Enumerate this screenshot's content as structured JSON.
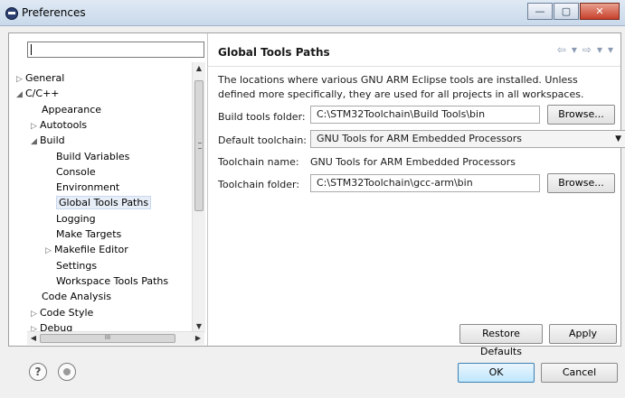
{
  "window": {
    "title": "Preferences",
    "minimize": "—",
    "maximize": "▢",
    "close": "✕"
  },
  "filter": {
    "value": ""
  },
  "tree": [
    {
      "label": "General",
      "arrow": "▷",
      "indent": 0
    },
    {
      "label": "C/C++",
      "arrow": "◢",
      "indent": 0
    },
    {
      "label": "Appearance",
      "arrow": "",
      "indent": 1
    },
    {
      "label": "Autotools",
      "arrow": "▷",
      "indent": 1
    },
    {
      "label": "Build",
      "arrow": "◢",
      "indent": 1
    },
    {
      "label": "Build Variables",
      "arrow": "",
      "indent": 2
    },
    {
      "label": "Console",
      "arrow": "",
      "indent": 2
    },
    {
      "label": "Environment",
      "arrow": "",
      "indent": 2
    },
    {
      "label": "Global Tools Paths",
      "arrow": "",
      "indent": 2,
      "selected": true
    },
    {
      "label": "Logging",
      "arrow": "",
      "indent": 2
    },
    {
      "label": "Make Targets",
      "arrow": "",
      "indent": 2
    },
    {
      "label": "Makefile Editor",
      "arrow": "▷",
      "indent": 2
    },
    {
      "label": "Settings",
      "arrow": "",
      "indent": 2
    },
    {
      "label": "Workspace Tools Paths",
      "arrow": "",
      "indent": 2
    },
    {
      "label": "Code Analysis",
      "arrow": "",
      "indent": 1
    },
    {
      "label": "Code Style",
      "arrow": "▷",
      "indent": 1
    },
    {
      "label": "Debug",
      "arrow": "▷",
      "indent": 1
    }
  ],
  "page": {
    "title": "Global Tools Paths",
    "nav": {
      "back": "⇦",
      "back_menu": "▾",
      "forward": "⇨",
      "forward_menu": "▾",
      "view_menu": "▾"
    },
    "description": "The locations where various GNU ARM Eclipse tools are installed. Unless defined more specifically, they are used for all projects in all workspaces.",
    "build_tools_label": "Build tools folder:",
    "build_tools_value": "C:\\STM32Toolchain\\Build Tools\\bin",
    "default_toolchain_label": "Default toolchain:",
    "default_toolchain_value": "GNU Tools for ARM Embedded Processors",
    "toolchain_name_label": "Toolchain name:",
    "toolchain_name_value": "GNU Tools for ARM Embedded Processors",
    "toolchain_folder_label": "Toolchain folder:",
    "toolchain_folder_value": "C:\\STM32Toolchain\\gcc-arm\\bin",
    "browse": "Browse...",
    "restore_defaults": "Restore Defaults",
    "apply": "Apply"
  },
  "footer": {
    "help": "?",
    "ok": "OK",
    "cancel": "Cancel"
  },
  "scroll": {
    "up": "▲",
    "down": "▼",
    "left": "◀",
    "right": "▶",
    "hgrip": "III"
  },
  "colors": {
    "selection": "#e7eef8",
    "primary_button": "#bee6fd"
  }
}
